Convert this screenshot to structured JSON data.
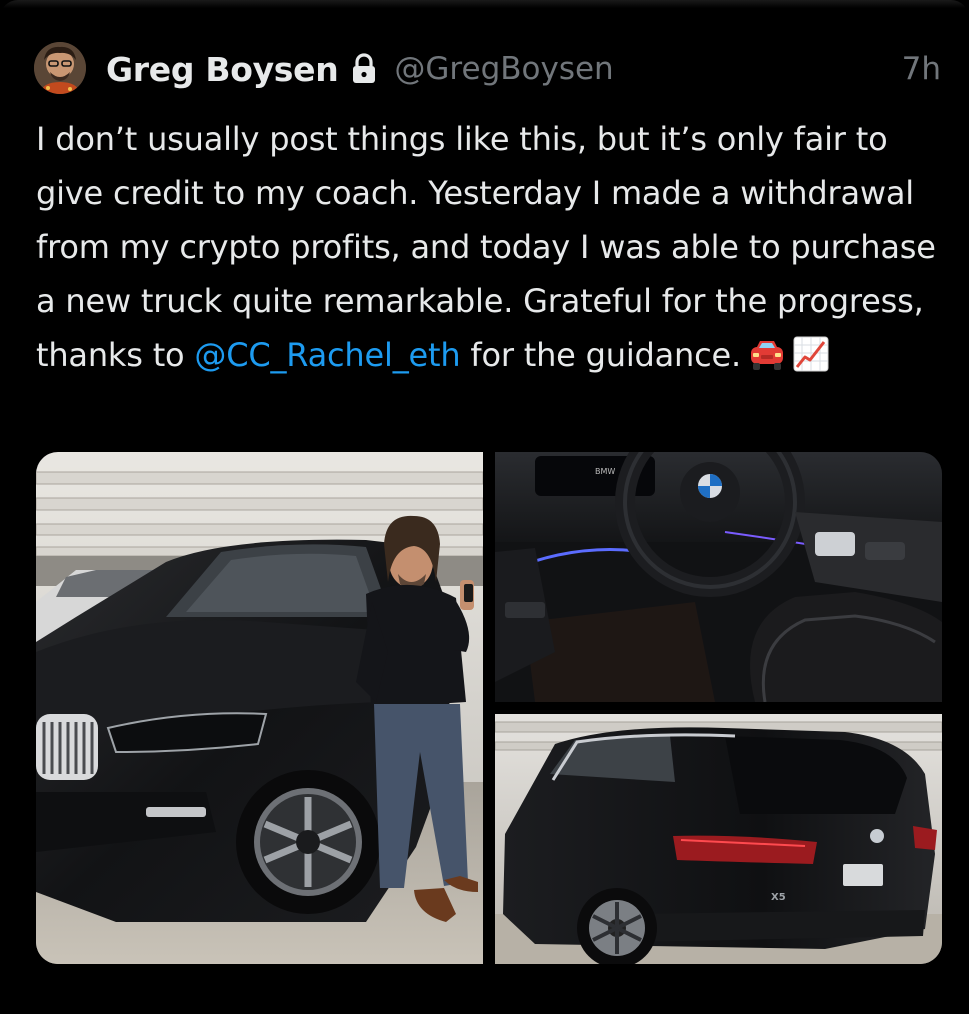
{
  "tweet": {
    "author": {
      "display_name": "Greg Boysen",
      "handle": "@GregBoysen",
      "protected_icon": "lock-icon",
      "avatar_icon": "profile-avatar"
    },
    "timestamp": "7h",
    "text_before_mention": "I don’t usually post things like this, but it’s only fair to give credit to my coach. Yesterday I made a withdrawal from my crypto profits, and today I was able to purchase a new truck quite remarkable. Grateful for the progress, thanks to ",
    "mention": "@CC_Rachel_eth",
    "text_after_mention": " for the guidance.",
    "emojis": [
      "car-emoji",
      "chart-increasing-emoji"
    ],
    "media": [
      {
        "name": "photo-man-with-suv",
        "icon": "photo"
      },
      {
        "name": "photo-car-interior",
        "icon": "photo"
      },
      {
        "name": "photo-suv-rear",
        "icon": "photo"
      }
    ],
    "media_text": {
      "steering_brand": "BMW",
      "rear_badge": "X5"
    }
  },
  "colors": {
    "background": "#000000",
    "text_primary": "#e7e9ea",
    "text_secondary": "#71767b",
    "mention": "#1d9bf0"
  }
}
